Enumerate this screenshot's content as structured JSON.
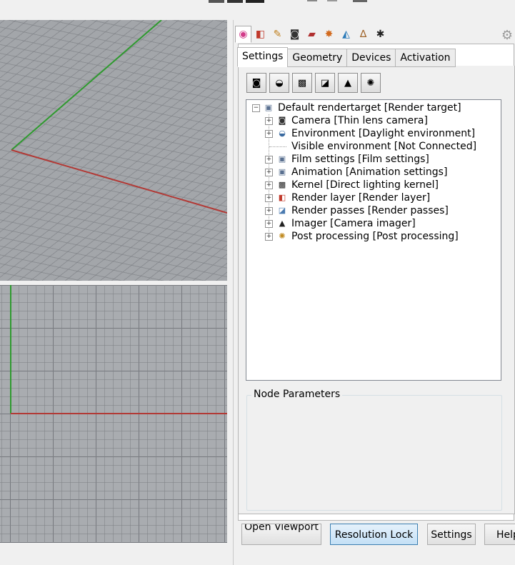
{
  "top_toolbar": {
    "icons": [
      "toolbar-glyph-icon",
      "toolbar-glyph-icon"
    ]
  },
  "viewports": {
    "perspective": {
      "x_axis_color": "#b23a36",
      "y_axis_color": "#2f9a2f"
    },
    "front": {
      "x_axis_color": "#b23a36",
      "y_axis_color": "#2f9a2f"
    }
  },
  "icon_tabs": [
    {
      "name": "color-wheel-icon",
      "glyph": "◉",
      "color": "#d23c8a"
    },
    {
      "name": "materials-icon",
      "glyph": "◧",
      "color": "#c0392b"
    },
    {
      "name": "edit-icon",
      "glyph": "✎",
      "color": "#c08020"
    },
    {
      "name": "camera-icon",
      "glyph": "◙",
      "color": "#333333"
    },
    {
      "name": "book-icon",
      "glyph": "▰",
      "color": "#b03030"
    },
    {
      "name": "burst-icon",
      "glyph": "✸",
      "color": "#d26a1e"
    },
    {
      "name": "objects-icon",
      "glyph": "◭",
      "color": "#2a7ab8"
    },
    {
      "name": "wand-icon",
      "glyph": "∆",
      "color": "#a0642a"
    },
    {
      "name": "star-gear-icon",
      "glyph": "✱",
      "color": "#222222"
    }
  ],
  "text_tabs": [
    "Settings",
    "Geometry",
    "Devices",
    "Activation"
  ],
  "toolbar_buttons": [
    {
      "name": "camera-icon",
      "glyph": "◙"
    },
    {
      "name": "environment-icon",
      "glyph": "◒"
    },
    {
      "name": "kernel-icon",
      "glyph": "▩"
    },
    {
      "name": "render-passes-icon",
      "glyph": "◪"
    },
    {
      "name": "imager-icon",
      "glyph": "▲"
    },
    {
      "name": "post-processing-icon",
      "glyph": "✺"
    }
  ],
  "tree": {
    "root": {
      "label": "Default rendertarget",
      "type": "[Render target]"
    },
    "children": [
      {
        "label": "Camera",
        "type": "[Thin lens camera]",
        "expandable": true,
        "icon": "camera-icon",
        "glyph": "◙",
        "color": "#333333"
      },
      {
        "label": "Environment",
        "type": "[Daylight environment]",
        "expandable": true,
        "icon": "environment-icon",
        "glyph": "◒",
        "color": "#3a6aa0"
      },
      {
        "label": "Visible environment",
        "type": "[Not Connected]",
        "expandable": false,
        "icon": "",
        "glyph": "",
        "color": "#000000"
      },
      {
        "label": "Film settings",
        "type": "[Film settings]",
        "expandable": true,
        "icon": "film-icon",
        "glyph": "▣",
        "color": "#5a7090"
      },
      {
        "label": "Animation",
        "type": "[Animation settings]",
        "expandable": true,
        "icon": "animation-icon",
        "glyph": "▣",
        "color": "#5a7090"
      },
      {
        "label": "Kernel",
        "type": "[Direct lighting kernel]",
        "expandable": true,
        "icon": "kernel-icon",
        "glyph": "▩",
        "color": "#222222"
      },
      {
        "label": "Render layer",
        "type": "[Render layer]",
        "expandable": true,
        "icon": "render-layer-icon",
        "glyph": "◧",
        "color": "#c0392b"
      },
      {
        "label": "Render passes",
        "type": "[Render passes]",
        "expandable": true,
        "icon": "render-passes-icon",
        "glyph": "◪",
        "color": "#4a7ab0"
      },
      {
        "label": "Imager",
        "type": "[Camera imager]",
        "expandable": true,
        "icon": "imager-icon",
        "glyph": "▲",
        "color": "#222222"
      },
      {
        "label": "Post processing",
        "type": "[Post processing]",
        "expandable": true,
        "icon": "post-processing-icon",
        "glyph": "✺",
        "color": "#c08a20"
      }
    ]
  },
  "node_parameters": {
    "title": "Node Parameters"
  },
  "buttons": {
    "open_viewport": "Open Viewport",
    "resolution_lock": "Resolution Lock",
    "settings": "Settings",
    "help": "Help"
  }
}
